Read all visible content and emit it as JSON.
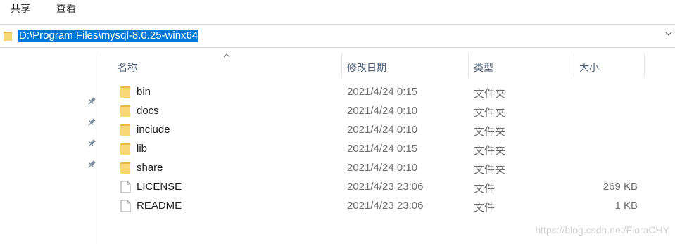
{
  "ribbon": {
    "tabs": [
      {
        "label": "共享"
      },
      {
        "label": "查看"
      }
    ]
  },
  "address_bar": {
    "path": "D:\\Program Files\\mysql-8.0.25-winx64"
  },
  "columns": {
    "name": "名称",
    "modified": "修改日期",
    "type": "类型",
    "size": "大小"
  },
  "files": [
    {
      "name": "bin",
      "modified": "2021/4/24 0:15",
      "type": "文件夹",
      "size": "",
      "icon": "folder-icon"
    },
    {
      "name": "docs",
      "modified": "2021/4/24 0:10",
      "type": "文件夹",
      "size": "",
      "icon": "folder-icon"
    },
    {
      "name": "include",
      "modified": "2021/4/24 0:10",
      "type": "文件夹",
      "size": "",
      "icon": "folder-icon"
    },
    {
      "name": "lib",
      "modified": "2021/4/24 0:15",
      "type": "文件夹",
      "size": "",
      "icon": "folder-icon"
    },
    {
      "name": "share",
      "modified": "2021/4/24 0:10",
      "type": "文件夹",
      "size": "",
      "icon": "folder-icon"
    },
    {
      "name": "LICENSE",
      "modified": "2021/4/23 23:06",
      "type": "文件",
      "size": "269 KB",
      "icon": "file-icon"
    },
    {
      "name": "README",
      "modified": "2021/4/23 23:06",
      "type": "文件",
      "size": "1 KB",
      "icon": "file-icon"
    }
  ],
  "watermark": "https://blog.csdn.net/FloraCHY",
  "colors": {
    "selection": "#0078d7",
    "folder": "#f8d775",
    "header_text": "#4c607a"
  }
}
